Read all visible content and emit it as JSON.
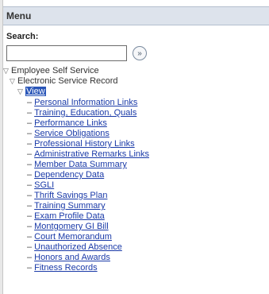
{
  "menu": {
    "title": "Menu"
  },
  "search": {
    "label": "Search:",
    "value": "",
    "go_icon": "go-arrow-icon"
  },
  "tree": {
    "root": "Employee Self Service",
    "folder": "Electronic Service Record",
    "selected": "View",
    "links": [
      "Personal Information Links",
      "Training, Education, Quals",
      "Performance Links",
      "Service Obligations",
      "Professional History Links",
      "Administrative Remarks Links",
      "Member Data Summary",
      "Dependency Data",
      "SGLI",
      "Thrift Savings Plan",
      "Training Summary",
      "Exam Profile Data",
      "Montgomery GI Bill",
      "Court Memorandum",
      "Unauthorized Absence",
      "Honors and Awards",
      "Fitness Records"
    ]
  }
}
